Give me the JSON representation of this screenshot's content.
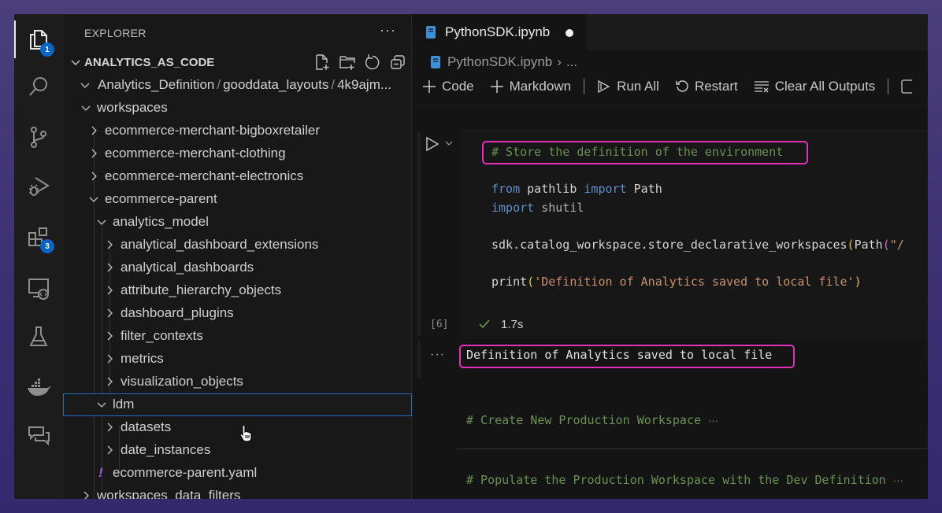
{
  "activity_bar": {
    "items": [
      {
        "name": "explorer",
        "badge": "1"
      },
      {
        "name": "search"
      },
      {
        "name": "source-control"
      },
      {
        "name": "run-and-debug"
      },
      {
        "name": "extensions",
        "badge": "3"
      },
      {
        "name": "remote-explorer"
      },
      {
        "name": "testing"
      },
      {
        "name": "docker"
      },
      {
        "name": "chat"
      }
    ]
  },
  "sidebar": {
    "title": "EXPLORER",
    "more": "···",
    "section": "ANALYTICS_AS_CODE",
    "path": {
      "parts": [
        "Analytics_Definition",
        "gooddata_layouts",
        "4k9ajm..."
      ]
    },
    "tree": [
      {
        "label": "workspaces",
        "expanded": true,
        "level": 1
      },
      {
        "label": "ecommerce-merchant-bigboxretailer",
        "expanded": false,
        "level": 2
      },
      {
        "label": "ecommerce-merchant-clothing",
        "expanded": false,
        "level": 2
      },
      {
        "label": "ecommerce-merchant-electronics",
        "expanded": false,
        "level": 2
      },
      {
        "label": "ecommerce-parent",
        "expanded": true,
        "level": 2
      },
      {
        "label": "analytics_model",
        "expanded": true,
        "level": 3
      },
      {
        "label": "analytical_dashboard_extensions",
        "expanded": false,
        "level": 4
      },
      {
        "label": "analytical_dashboards",
        "expanded": false,
        "level": 4
      },
      {
        "label": "attribute_hierarchy_objects",
        "expanded": false,
        "level": 4
      },
      {
        "label": "dashboard_plugins",
        "expanded": false,
        "level": 4
      },
      {
        "label": "filter_contexts",
        "expanded": false,
        "level": 4
      },
      {
        "label": "metrics",
        "expanded": false,
        "level": 4
      },
      {
        "label": "visualization_objects",
        "expanded": false,
        "level": 4
      },
      {
        "label": "ldm",
        "expanded": true,
        "level": 3,
        "selected": true
      },
      {
        "label": "datasets",
        "expanded": false,
        "level": 4
      },
      {
        "label": "date_instances",
        "expanded": false,
        "level": 4
      },
      {
        "label": "ecommerce-parent.yaml",
        "file": true,
        "icon": "!",
        "level": 3
      },
      {
        "label": "workspaces_data_filters",
        "expanded": false,
        "level": 1
      }
    ]
  },
  "editor": {
    "tab": {
      "label": "PythonSDK.ipynb",
      "dirty": true
    },
    "breadcrumb": {
      "file": "PythonSDK.ipynb",
      "rest": "..."
    },
    "toolbar": {
      "code": "Code",
      "markdown": "Markdown",
      "run_all": "Run All",
      "restart": "Restart",
      "clear_all": "Clear All Outputs"
    },
    "cell": {
      "comment": "# Store the definition of the environment",
      "line_from": "from",
      "line_pathlib": "pathlib",
      "line_import": "import",
      "line_path": "Path",
      "line_import2": "import",
      "line_shutil": "shutil",
      "line_sdk": "sdk.catalog_workspace.store_declarative_workspaces",
      "line_sdk_open": "(",
      "line_sdk_path": "Path",
      "line_sdk_open2": "(",
      "line_sdk_str": "\"/",
      "line_print": "print",
      "line_print_open": "(",
      "line_print_str": "'Definition of Analytics saved to local file'",
      "line_print_close": ")",
      "exec_count": "[6]",
      "exec_time": "1.7s",
      "output_dots": "···",
      "output": "Definition of Analytics saved to local file"
    },
    "markdown_cells": [
      {
        "text": "# Create New Production Workspace",
        "ellipsis": "···"
      },
      {
        "text": "# Populate the Production Workspace with the Dev Definition",
        "ellipsis": "···"
      }
    ]
  },
  "colors": {
    "highlight": "#e52fb8",
    "badge": "#0a64c4",
    "selection": "#1f6fc5"
  }
}
